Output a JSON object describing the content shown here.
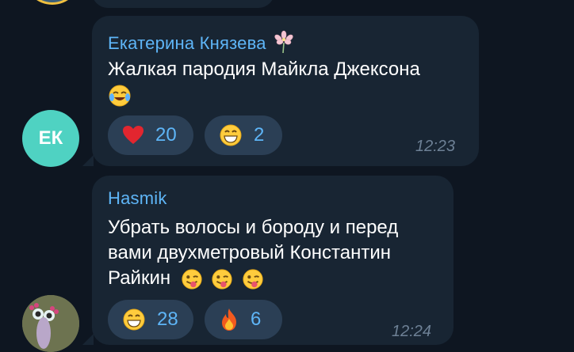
{
  "messages": [
    {
      "sender": "Екатерина Князева",
      "text_line1": "Жалкая пародия Майкла Джексона",
      "avatar_initials": "ЕК",
      "reactions": [
        {
          "emoji": "red-heart",
          "count": "20"
        },
        {
          "emoji": "grinning-face",
          "count": "2"
        }
      ],
      "time": "12:23"
    },
    {
      "sender": "Hasmik",
      "text_line1": "Убрать волосы и бороду и перед",
      "text_line2": "вами двухметровый Константин",
      "text_line3": "Райкин",
      "reactions": [
        {
          "emoji": "grinning-face",
          "count": "28"
        },
        {
          "emoji": "fire",
          "count": "6"
        }
      ],
      "time": "12:24"
    }
  ],
  "colors": {
    "background": "#0e1621",
    "bubble": "#182533",
    "sender_name": "#5eb5f7",
    "reaction_pill": "#2b3f55",
    "avatar_ek": "#4fd2c2"
  }
}
